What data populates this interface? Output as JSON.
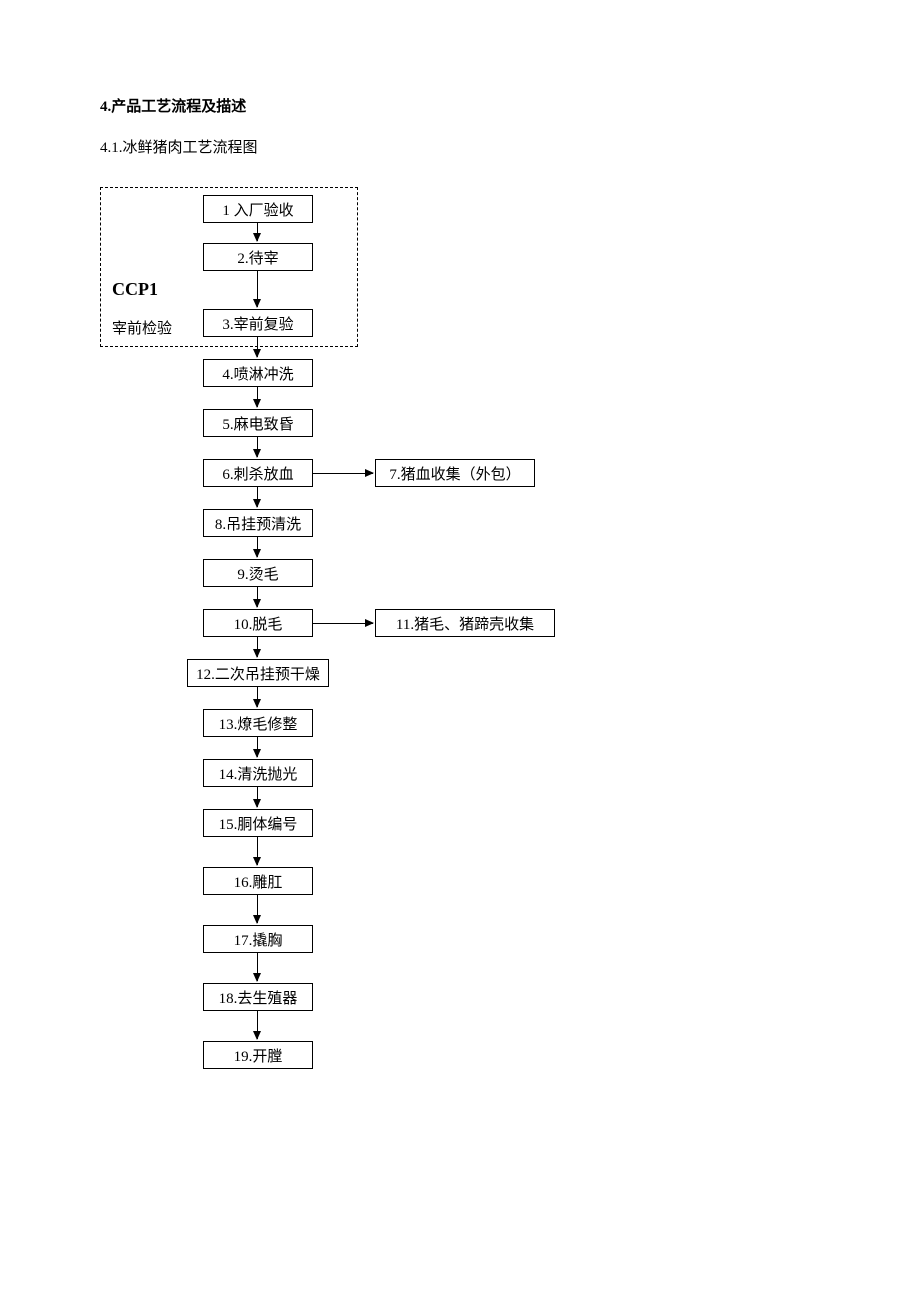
{
  "heading": "4.产品工艺流程及描述",
  "subheading": "4.1.冰鲜猪肉工艺流程图",
  "ccp": {
    "main": "CCP1",
    "sub": "宰前检验"
  },
  "steps": {
    "s1": "1 入厂验收",
    "s2": "2.待宰",
    "s3": "3.宰前复验",
    "s4": "4.喷淋冲洗",
    "s5": "5.麻电致昏",
    "s6": "6.刺杀放血",
    "s7": "7.猪血收集（外包）",
    "s8": "8.吊挂预清洗",
    "s9": "9.烫毛",
    "s10": "10.脱毛",
    "s11": "11.猪毛、猪蹄壳收集",
    "s12": "12.二次吊挂预干燥",
    "s13": "13.燎毛修整",
    "s14": "14.清洗抛光",
    "s15": "15.胴体编号",
    "s16": "16.雕肛",
    "s17": "17.撬胸",
    "s18": "18.去生殖器",
    "s19": "19.开膛"
  }
}
